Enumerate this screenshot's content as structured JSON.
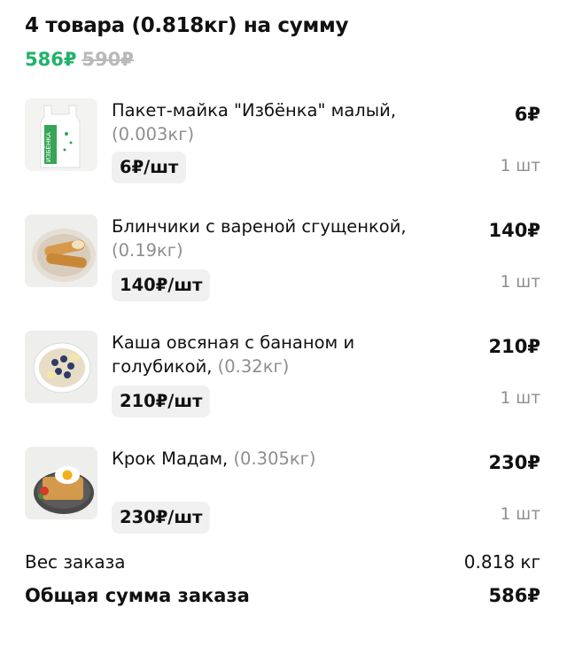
{
  "header": {
    "title": "4 товара (0.818кг) на сумму",
    "price_new": "586₽",
    "price_old": "590₽"
  },
  "items": [
    {
      "name": "Пакет-майка \"Избёнка\" малый,",
      "weight": "(0.003кг)",
      "unit_price": "6₽/шт",
      "total": "6₽",
      "qty": "1 шт",
      "icon": "bag-icon",
      "image_text": "ИЗБЁНКА"
    },
    {
      "name": "Блинчики с вареной сгущенкой,",
      "weight": "(0.19кг)",
      "unit_price": "140₽/шт",
      "total": "140₽",
      "qty": "1 шт",
      "icon": "pancakes-icon"
    },
    {
      "name_line1": "Каша овсяная с бананом и",
      "name_line2": "голубикой,",
      "weight": "(0.32кг)",
      "unit_price": "210₽/шт",
      "total": "210₽",
      "qty": "1 шт",
      "icon": "porridge-icon"
    },
    {
      "name": "Крок Мадам,",
      "weight": "(0.305кг)",
      "unit_price": "230₽/шт",
      "total": "230₽",
      "qty": "1 шт",
      "icon": "croque-madame-icon"
    }
  ],
  "summary": {
    "weight_label": "Вес заказа",
    "weight_value": "0.818 кг",
    "total_label": "Общая сумма заказа",
    "total_value": "586₽"
  },
  "colors": {
    "accent_green": "#20b26b",
    "old_price_gray": "#b9b9b9",
    "muted_text": "#8e8e8e",
    "chip_background": "#f0f0f0"
  }
}
